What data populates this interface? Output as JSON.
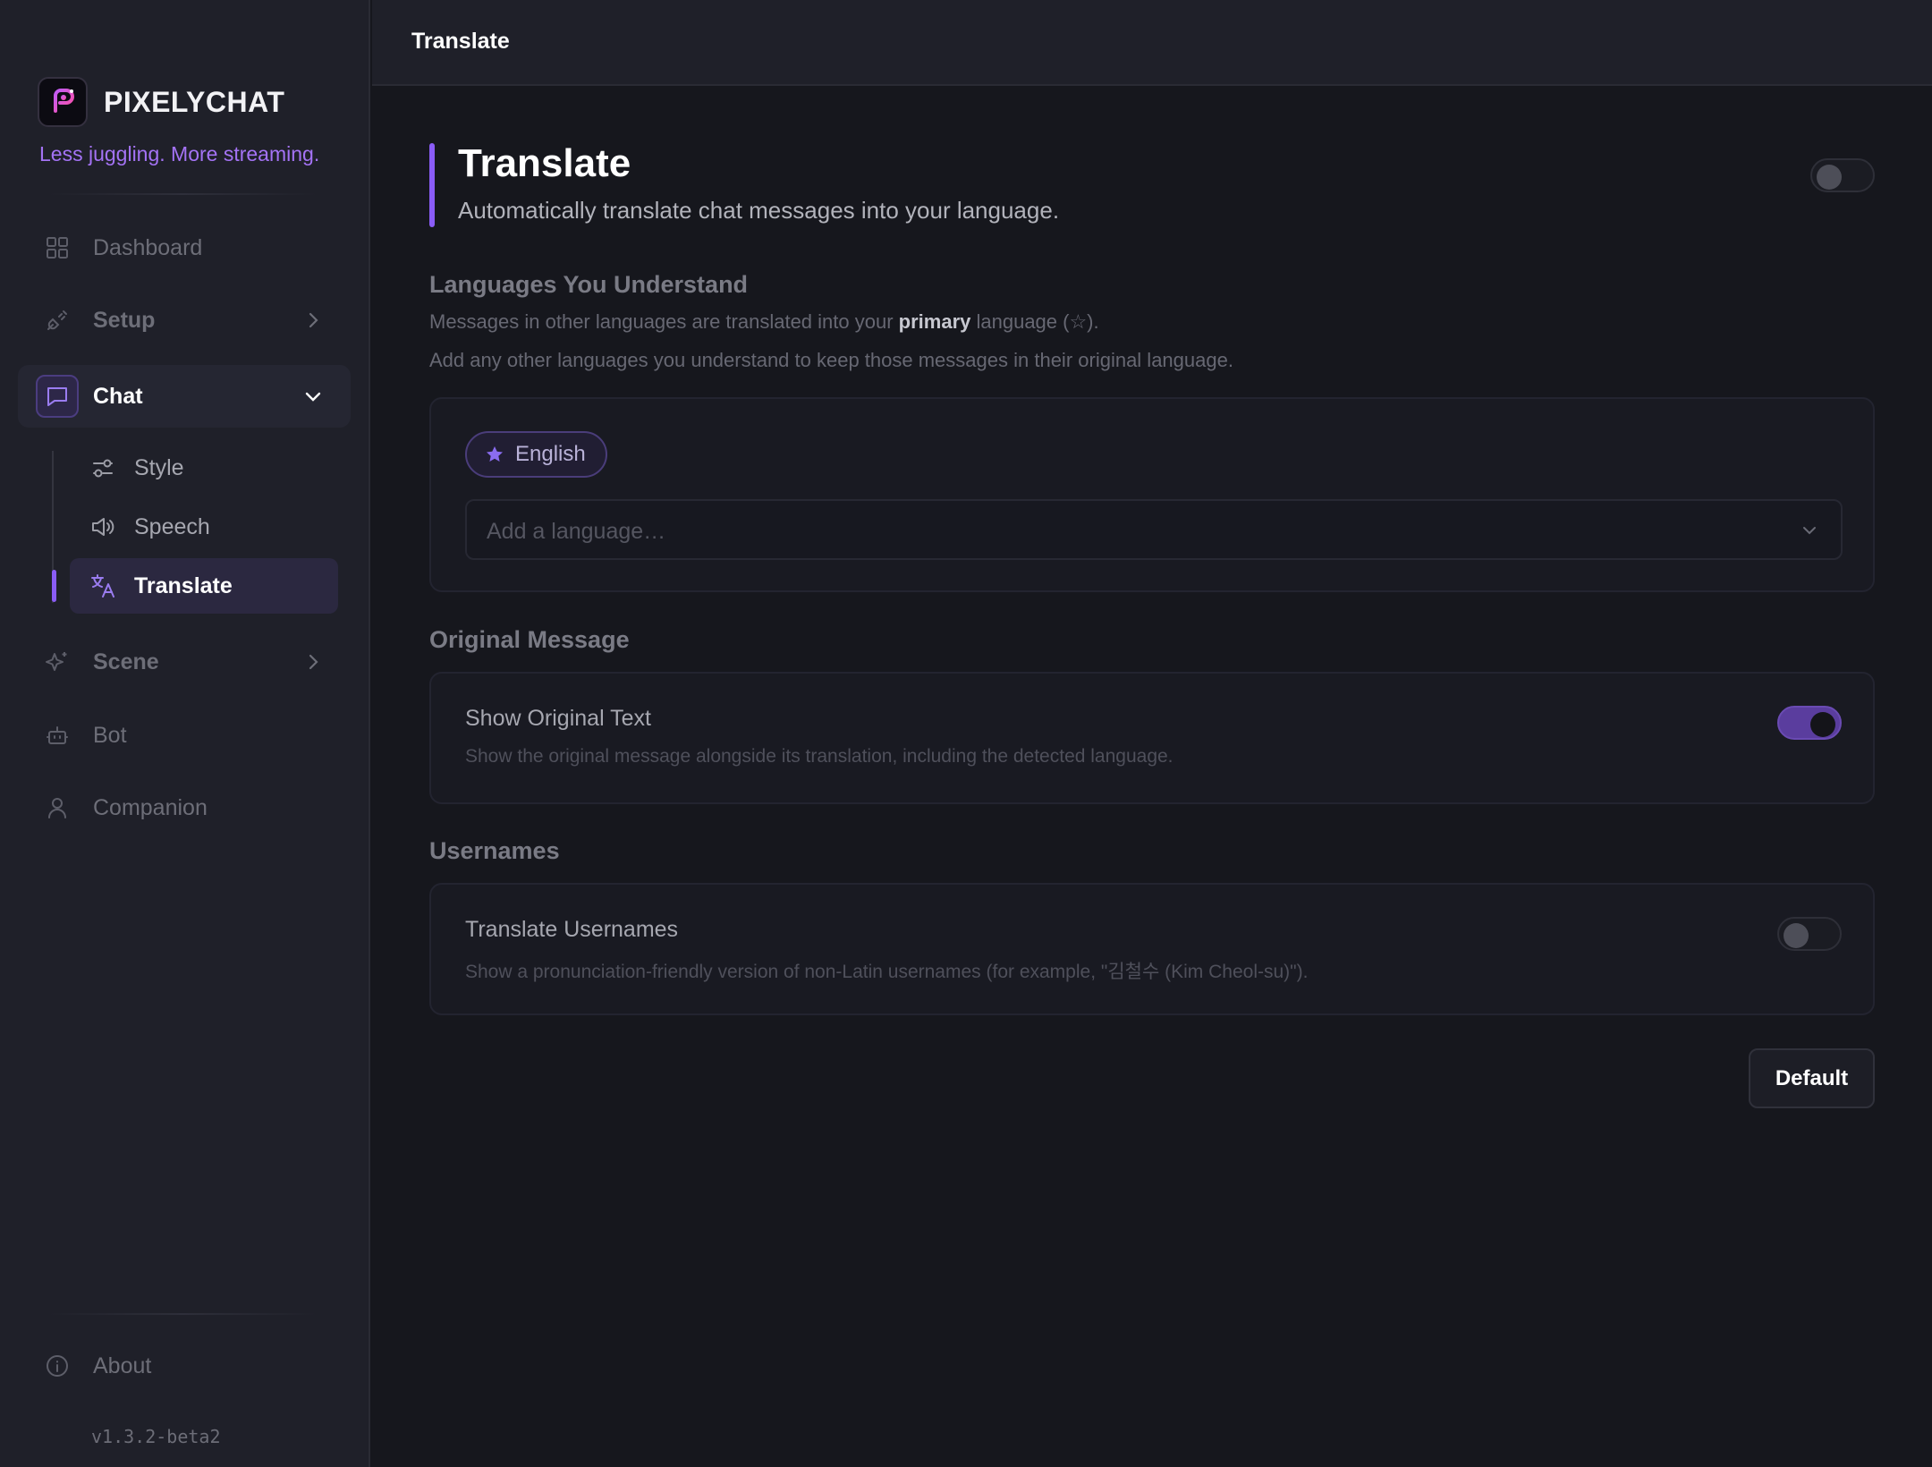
{
  "app": {
    "name": "PIXELYCHAT",
    "tagline": "Less juggling. More streaming.",
    "version": "v1.3.2-beta2"
  },
  "sidebar": {
    "items": [
      {
        "label": "Dashboard",
        "icon": "grid-icon"
      },
      {
        "label": "Setup",
        "icon": "plug-icon",
        "expandable": true,
        "expanded": false
      },
      {
        "label": "Chat",
        "icon": "chat-icon",
        "expandable": true,
        "expanded": true,
        "children": [
          {
            "label": "Style",
            "icon": "sliders-icon"
          },
          {
            "label": "Speech",
            "icon": "speaker-icon"
          },
          {
            "label": "Translate",
            "icon": "translate-icon",
            "active": true
          }
        ]
      },
      {
        "label": "Scene",
        "icon": "sparkle-icon",
        "expandable": true,
        "expanded": false
      },
      {
        "label": "Bot",
        "icon": "robot-icon"
      },
      {
        "label": "Companion",
        "icon": "user-icon"
      }
    ],
    "footer": {
      "about_label": "About",
      "about_icon": "info-icon"
    }
  },
  "topbar": {
    "title": "Translate"
  },
  "page": {
    "title": "Translate",
    "subtitle": "Automatically translate chat messages into your language.",
    "enabled": false
  },
  "languages": {
    "title": "Languages You Understand",
    "desc_before": "Messages in other languages are translated into your ",
    "desc_bold": "primary",
    "desc_after": " language (☆).",
    "desc2": "Add any other languages you understand to keep those messages in their original language.",
    "chips": [
      {
        "label": "English",
        "primary": true
      }
    ],
    "select_placeholder": "Add a language…"
  },
  "original_message": {
    "title": "Original Message",
    "row_title": "Show Original Text",
    "row_desc": "Show the original message alongside its translation, including the detected language.",
    "enabled": true
  },
  "usernames": {
    "title": "Usernames",
    "row_title": "Translate Usernames",
    "row_desc": "Show a pronunciation-friendly version of non-Latin usernames (for example, \"김철수 (Kim Cheol-su)\").",
    "enabled": false
  },
  "actions": {
    "default_label": "Default"
  },
  "colors": {
    "accent": "#8a5cf6",
    "background": "#16171d",
    "sidebar": "#1f2029"
  }
}
